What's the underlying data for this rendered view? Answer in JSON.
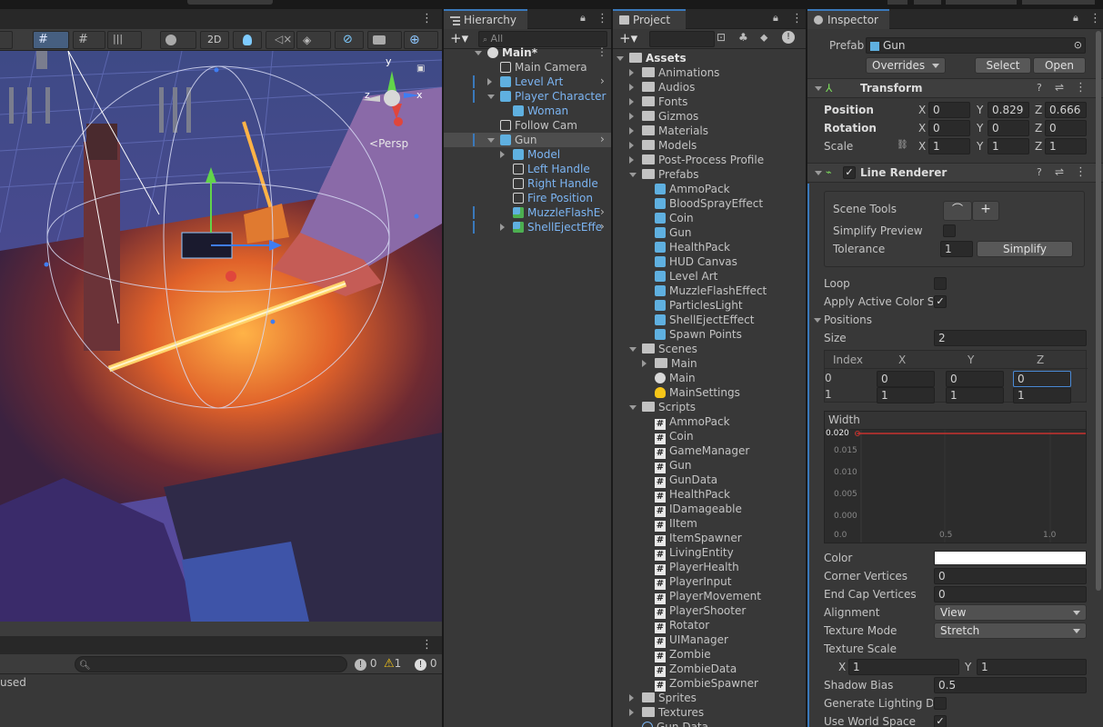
{
  "scene": {
    "view_2d": "2D",
    "persp": "Persp",
    "gizmo_axes": {
      "x": "x",
      "y": "y",
      "z": "z"
    }
  },
  "console": {
    "search_placeholder": "",
    "partial_message": "used",
    "counts": {
      "info": "0",
      "warn": "1",
      "error": "0"
    }
  },
  "hierarchy": {
    "tab": "Hierarchy",
    "search_placeholder": "All",
    "rows": [
      {
        "label": "Main*",
        "depth": 0,
        "icon": "unity-icon",
        "expand": "down",
        "bold": true,
        "kebab": true
      },
      {
        "label": "Main Camera",
        "depth": 1,
        "icon": "gameobject-icon"
      },
      {
        "label": "Level Art",
        "depth": 1,
        "icon": "prefab-icon",
        "expand": "right",
        "blue": true,
        "arrow": true,
        "bar": true
      },
      {
        "label": "Player Character",
        "depth": 1,
        "icon": "prefab-icon",
        "expand": "down",
        "blue": true,
        "bar": true
      },
      {
        "label": "Woman",
        "depth": 2,
        "icon": "prefab-icon",
        "blue": true
      },
      {
        "label": "Follow Cam",
        "depth": 1,
        "icon": "gameobject-icon"
      },
      {
        "label": "Gun",
        "depth": 1,
        "icon": "prefab-icon",
        "expand": "down",
        "selected": true,
        "arrow": true,
        "bar": true
      },
      {
        "label": "Model",
        "depth": 2,
        "icon": "prefab-icon",
        "expand": "right",
        "blue": true
      },
      {
        "label": "Left Handle",
        "depth": 2,
        "icon": "gameobject-icon",
        "blue": true
      },
      {
        "label": "Right Handle",
        "depth": 2,
        "icon": "gameobject-icon",
        "blue": true
      },
      {
        "label": "Fire Position",
        "depth": 2,
        "icon": "gameobject-icon",
        "blue": true
      },
      {
        "label": "MuzzleFlashE",
        "depth": 2,
        "icon": "prefab-added-icon",
        "blue": true,
        "arrow": true,
        "bar": true
      },
      {
        "label": "ShellEjectEffe",
        "depth": 2,
        "icon": "prefab-added-icon",
        "expand": "right",
        "blue": true,
        "arrow": true,
        "bar": true
      }
    ]
  },
  "project": {
    "tab": "Project",
    "search_placeholder": "",
    "rows": [
      {
        "label": "Assets",
        "depth": 0,
        "icon": "folder-open-icon",
        "expand": "down",
        "bold": true
      },
      {
        "label": "Animations",
        "depth": 1,
        "icon": "folder-icon",
        "expand": "right"
      },
      {
        "label": "Audios",
        "depth": 1,
        "icon": "folder-icon",
        "expand": "right"
      },
      {
        "label": "Fonts",
        "depth": 1,
        "icon": "folder-icon",
        "expand": "right"
      },
      {
        "label": "Gizmos",
        "depth": 1,
        "icon": "folder-icon",
        "expand": "right"
      },
      {
        "label": "Materials",
        "depth": 1,
        "icon": "folder-icon",
        "expand": "right"
      },
      {
        "label": "Models",
        "depth": 1,
        "icon": "folder-icon",
        "expand": "right"
      },
      {
        "label": "Post-Process Profile",
        "depth": 1,
        "icon": "folder-icon",
        "expand": "right"
      },
      {
        "label": "Prefabs",
        "depth": 1,
        "icon": "folder-open-icon",
        "expand": "down"
      },
      {
        "label": "AmmoPack",
        "depth": 2,
        "icon": "prefab-icon"
      },
      {
        "label": "BloodSprayEffect",
        "depth": 2,
        "icon": "prefab-icon"
      },
      {
        "label": "Coin",
        "depth": 2,
        "icon": "prefab-icon"
      },
      {
        "label": "Gun",
        "depth": 2,
        "icon": "prefab-icon"
      },
      {
        "label": "HealthPack",
        "depth": 2,
        "icon": "prefab-icon"
      },
      {
        "label": "HUD Canvas",
        "depth": 2,
        "icon": "prefab-icon"
      },
      {
        "label": "Level Art",
        "depth": 2,
        "icon": "prefab-icon"
      },
      {
        "label": "MuzzleFlashEffect",
        "depth": 2,
        "icon": "prefab-icon"
      },
      {
        "label": "ParticlesLight",
        "depth": 2,
        "icon": "prefab-icon"
      },
      {
        "label": "ShellEjectEffect",
        "depth": 2,
        "icon": "prefab-icon"
      },
      {
        "label": "Spawn Points",
        "depth": 2,
        "icon": "prefab-icon"
      },
      {
        "label": "Scenes",
        "depth": 1,
        "icon": "folder-open-icon",
        "expand": "down"
      },
      {
        "label": "Main",
        "depth": 2,
        "icon": "folder-icon",
        "expand": "right"
      },
      {
        "label": "Main",
        "depth": 2,
        "icon": "unity-icon"
      },
      {
        "label": "MainSettings",
        "depth": 2,
        "icon": "lightbulb-icon"
      },
      {
        "label": "Scripts",
        "depth": 1,
        "icon": "folder-open-icon",
        "expand": "down"
      },
      {
        "label": "AmmoPack",
        "depth": 2,
        "icon": "script-icon"
      },
      {
        "label": "Coin",
        "depth": 2,
        "icon": "script-icon"
      },
      {
        "label": "GameManager",
        "depth": 2,
        "icon": "script-icon"
      },
      {
        "label": "Gun",
        "depth": 2,
        "icon": "script-icon"
      },
      {
        "label": "GunData",
        "depth": 2,
        "icon": "script-icon"
      },
      {
        "label": "HealthPack",
        "depth": 2,
        "icon": "script-icon"
      },
      {
        "label": "IDamageable",
        "depth": 2,
        "icon": "script-icon"
      },
      {
        "label": "IItem",
        "depth": 2,
        "icon": "script-icon"
      },
      {
        "label": "ItemSpawner",
        "depth": 2,
        "icon": "script-icon"
      },
      {
        "label": "LivingEntity",
        "depth": 2,
        "icon": "script-icon"
      },
      {
        "label": "PlayerHealth",
        "depth": 2,
        "icon": "script-icon"
      },
      {
        "label": "PlayerInput",
        "depth": 2,
        "icon": "script-icon"
      },
      {
        "label": "PlayerMovement",
        "depth": 2,
        "icon": "script-icon"
      },
      {
        "label": "PlayerShooter",
        "depth": 2,
        "icon": "script-icon"
      },
      {
        "label": "Rotator",
        "depth": 2,
        "icon": "script-icon"
      },
      {
        "label": "UIManager",
        "depth": 2,
        "icon": "script-icon"
      },
      {
        "label": "Zombie",
        "depth": 2,
        "icon": "script-icon"
      },
      {
        "label": "ZombieData",
        "depth": 2,
        "icon": "script-icon"
      },
      {
        "label": "ZombieSpawner",
        "depth": 2,
        "icon": "script-icon"
      },
      {
        "label": "Sprites",
        "depth": 1,
        "icon": "folder-icon",
        "expand": "right"
      },
      {
        "label": "Textures",
        "depth": 1,
        "icon": "folder-icon",
        "expand": "right"
      },
      {
        "label": "Gun Data",
        "depth": 1,
        "icon": "scriptable-icon"
      }
    ]
  },
  "inspector": {
    "tab": "Inspector",
    "prefab": {
      "label": "Prefab",
      "value": "Gun",
      "overrides": "Overrides",
      "select": "Select",
      "open": "Open"
    },
    "transform": {
      "title": "Transform",
      "rows": [
        {
          "label": "Position",
          "x": "0",
          "y": "0.829",
          "z": "0.666"
        },
        {
          "label": "Rotation",
          "x": "0",
          "y": "0",
          "z": "0"
        },
        {
          "label": "Scale",
          "x": "1",
          "y": "1",
          "z": "1"
        }
      ],
      "axis": {
        "x": "X",
        "y": "Y",
        "z": "Z"
      }
    },
    "line_renderer": {
      "title": "Line Renderer",
      "enabled": true,
      "scene_tools": "Scene Tools",
      "simplify_preview": "Simplify Preview",
      "tolerance_label": "Tolerance",
      "tolerance": "1",
      "simplify_btn": "Simplify",
      "loop": "Loop",
      "apply_color": "Apply Active Color Sp",
      "apply_checked": true,
      "positions": "Positions",
      "size_label": "Size",
      "size": "2",
      "table_headers": [
        "Index",
        "X",
        "Y",
        "Z"
      ],
      "table_rows": [
        [
          "0",
          "0",
          "0",
          "0"
        ],
        [
          "1",
          "1",
          "1",
          "1"
        ]
      ],
      "width_label": "Width",
      "width_value": "0.020",
      "width_y_ticks": [
        "0.015",
        "0.010",
        "0.005",
        "0.000"
      ],
      "width_x_ticks": [
        "0.0",
        "0.5",
        "1.0"
      ],
      "color_label": "Color",
      "color_value": "#ffffff",
      "corner_label": "Corner Vertices",
      "corner": "0",
      "endcap_label": "End Cap Vertices",
      "endcap": "0",
      "alignment_label": "Alignment",
      "alignment": "View",
      "texmode_label": "Texture Mode",
      "texmode": "Stretch",
      "texscale_label": "Texture Scale",
      "texscale_x": "1",
      "texscale_y": "1",
      "shadow_label": "Shadow Bias",
      "shadow": "0.5",
      "genlight_label": "Generate Lighting Da",
      "worldspace_label": "Use World Space",
      "worldspace_checked": true
    }
  },
  "colors": {
    "accent": "#3a79bb",
    "selection": "#4d4d4d",
    "blue_text": "#7cb5f3",
    "warn": "#f5c518"
  }
}
